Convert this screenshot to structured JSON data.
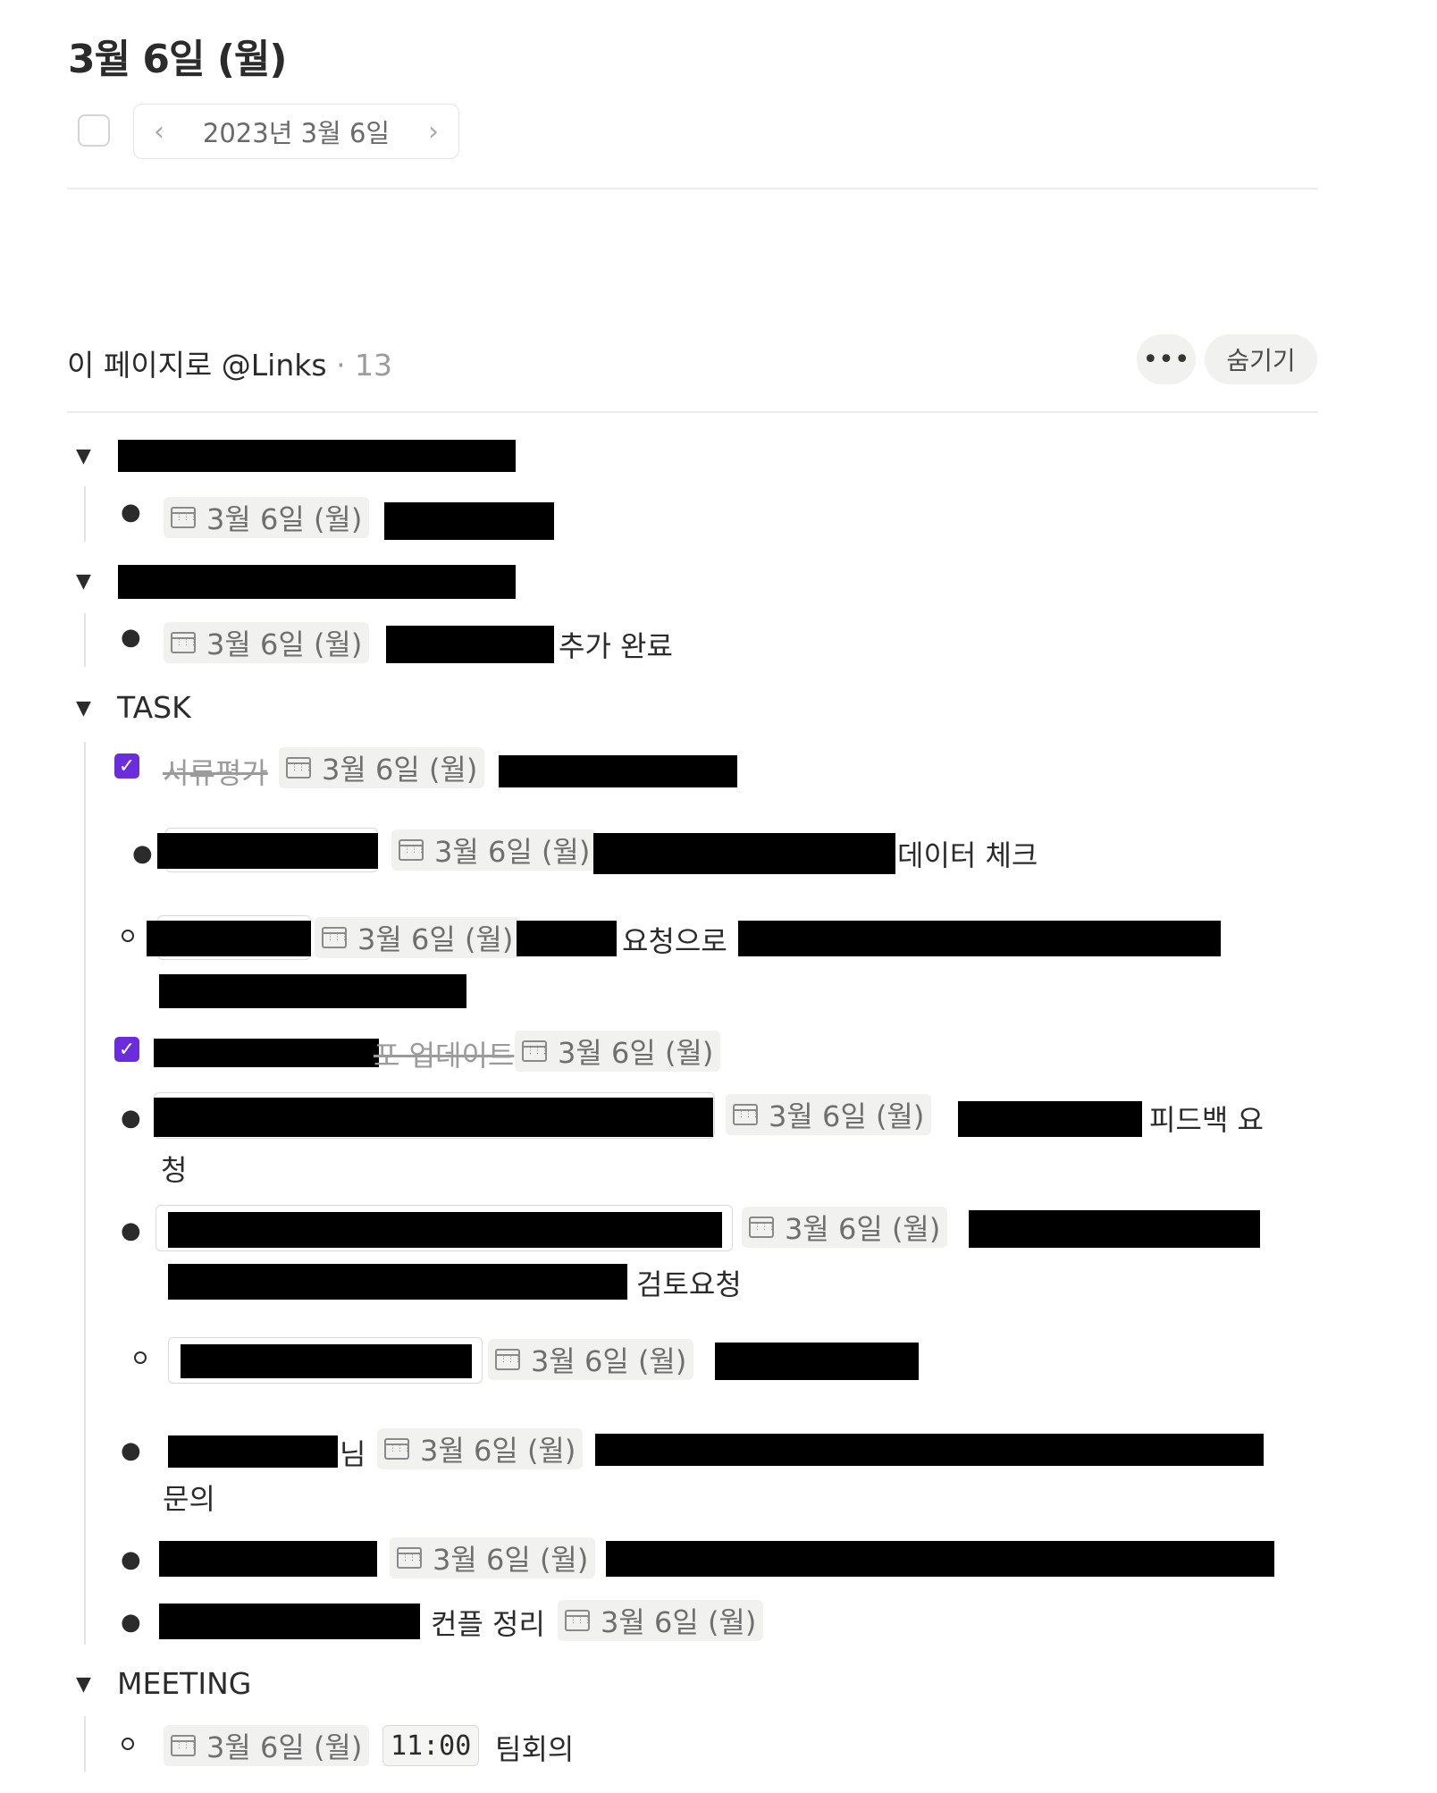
{
  "page": {
    "title": "3월 6일 (월)"
  },
  "date_nav": {
    "prev": "‹",
    "label": "2023년 3월 6일",
    "next": "›"
  },
  "links": {
    "title": "이 페이지로 @Links",
    "count": "· 13",
    "more": "•••",
    "hide": "숨기기"
  },
  "date_chip": "3월 6일 (월)",
  "sections": {
    "task": "TASK",
    "meeting": "MEETING"
  },
  "items": {
    "s2_suffix": "추가 완료",
    "t1_prefix": "서류평가",
    "t2_suffix": "데이터 체크",
    "t3_mid": "요청으로",
    "t4_strike_end": "포 업데이트",
    "t5_tail": "피드백 요",
    "t5_line2": "청",
    "t6_line2_end": "검토요청",
    "t8_mid": "님",
    "t8_line2": "문의",
    "t10_mid": "컨플 정리",
    "m1_time": "11:00",
    "m1_text": "팀회의"
  }
}
